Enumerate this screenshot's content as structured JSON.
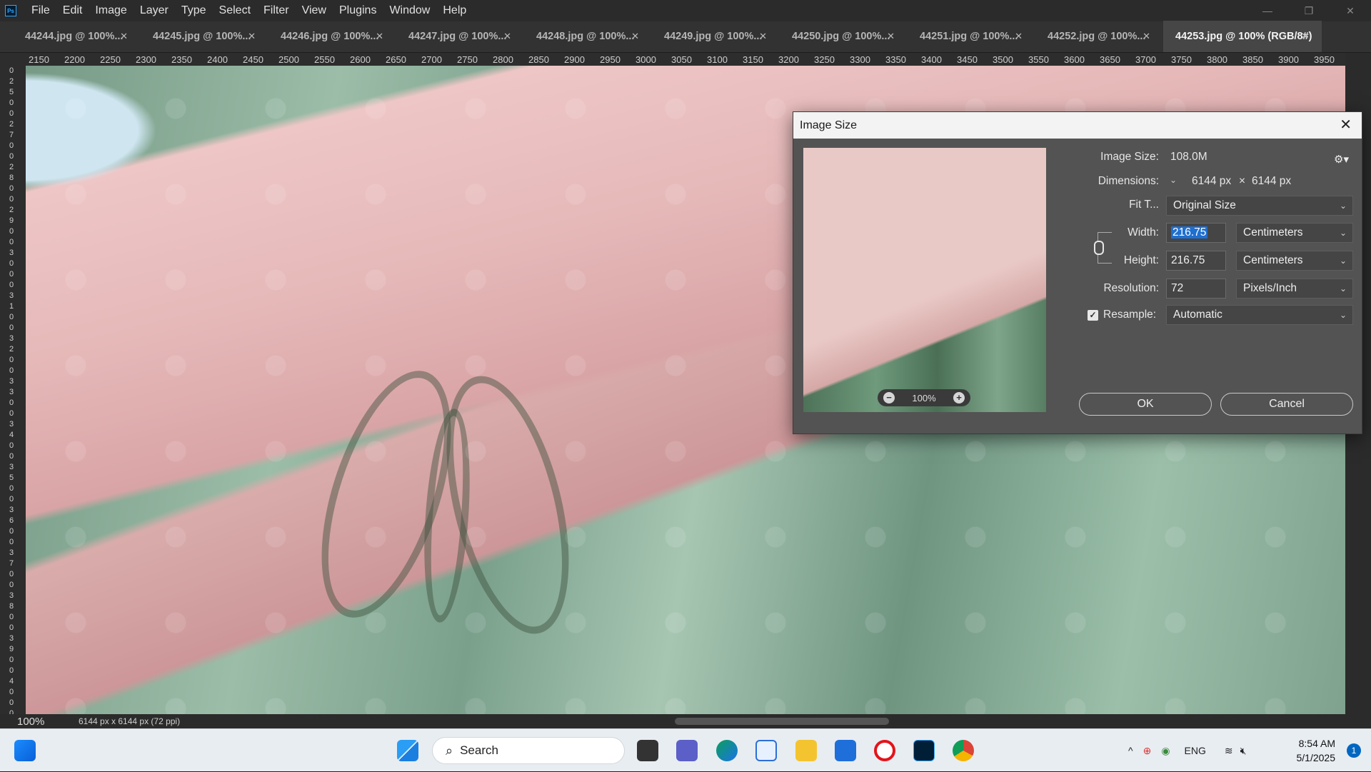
{
  "app": {
    "logo_text": "Ps"
  },
  "menu": [
    "File",
    "Edit",
    "Image",
    "Layer",
    "Type",
    "Select",
    "Filter",
    "View",
    "Plugins",
    "Window",
    "Help"
  ],
  "tabs": [
    "44244.jpg @ 100%...",
    "44245.jpg @ 100%...",
    "44246.jpg @ 100%...",
    "44247.jpg @ 100%...",
    "44248.jpg @ 100%...",
    "44249.jpg @ 100%...",
    "44250.jpg @ 100%...",
    "44251.jpg @ 100%...",
    "44252.jpg @ 100%...",
    "44253.jpg @ 100% (RGB/8#)"
  ],
  "ruler_ticks": [
    "2150",
    "2200",
    "2250",
    "2300",
    "2350",
    "2400",
    "2450",
    "2500",
    "2550",
    "2600",
    "2650",
    "2700",
    "2750",
    "2800",
    "2850",
    "2900",
    "2950",
    "3000",
    "3050",
    "3100",
    "3150",
    "3200",
    "3250",
    "3300",
    "3350",
    "3400",
    "3450",
    "3500",
    "3550",
    "3600",
    "3650",
    "3700",
    "3750",
    "3800",
    "3850",
    "3900",
    "3950"
  ],
  "vruler_digits": "0 2 5 0 0 2 7 0 0 2 8 0 0 2 9 0 0 3 0 0 0 3 1 0 0 3 2 0 0 3 3 0 0 3 4 0 0 3 5 0 0 3 6 0 0 3 7 0 0 3 8 0 0 3 9 0 0 4 0 0 0",
  "status": {
    "zoom": "100%",
    "doc_info": "6144 px x 6144 px (72 ppi)"
  },
  "dialog": {
    "title": "Image Size",
    "image_size_label": "Image Size:",
    "image_size_value": "108.0M",
    "dimensions_label": "Dimensions:",
    "dimensions_width": "6144 px",
    "dimensions_sep": "×",
    "dimensions_height": "6144 px",
    "fit_label": "Fit T...",
    "fit_value": "Original Size",
    "width_label": "Width:",
    "width_value": "216.75",
    "width_unit": "Centimeters",
    "height_label": "Height:",
    "height_value": "216.75",
    "height_unit": "Centimeters",
    "resolution_label": "Resolution:",
    "resolution_value": "72",
    "resolution_unit": "Pixels/Inch",
    "resample_label": "Resample:",
    "resample_value": "Automatic",
    "resample_checked": true,
    "preview_zoom": "100%",
    "ok_label": "OK",
    "cancel_label": "Cancel"
  },
  "taskbar": {
    "search_placeholder": "Search",
    "language": "ENG",
    "time": "8:54 AM",
    "date": "5/1/2025",
    "notification_count": "1"
  }
}
